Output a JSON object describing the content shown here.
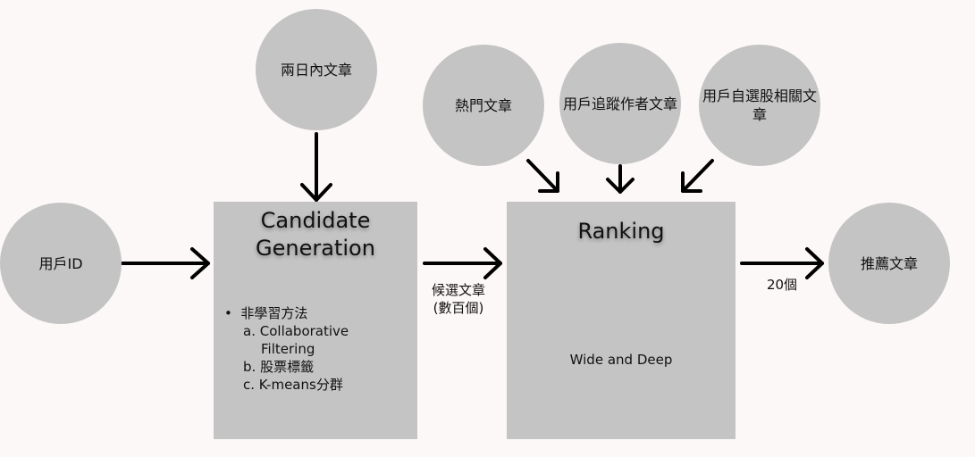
{
  "nodes": {
    "recent_articles": "兩日內文章",
    "hot_articles": "熱門文章",
    "followed_authors": "用戶追蹤作者文章",
    "watchlist_articles": "用戶自選股相關文章",
    "user_id": "用戶ID",
    "recommended": "推薦文章"
  },
  "candidate": {
    "title_line1": "Candidate",
    "title_line2": "Generation",
    "bullet": "•",
    "method": "非學習方法",
    "items": [
      {
        "marker": "a.",
        "text": "Collaborative",
        "text2": "Filtering"
      },
      {
        "marker": "b.",
        "text": "股票標籤"
      },
      {
        "marker": "c.",
        "text": "K-means分群"
      }
    ]
  },
  "ranking": {
    "title": "Ranking",
    "model": "Wide and Deep"
  },
  "edges": {
    "candidates_line1": "候選文章",
    "candidates_line2": "(數百個)",
    "output_count": "20個"
  }
}
